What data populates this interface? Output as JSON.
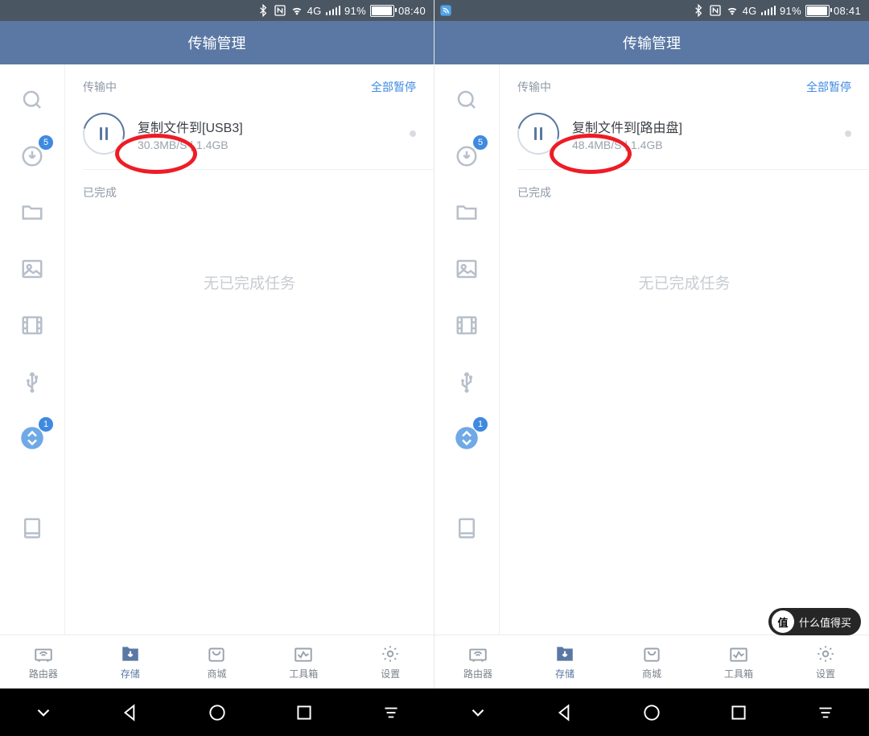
{
  "screens": [
    {
      "status": {
        "time": "08:40",
        "battery_pct": "91%",
        "has_cast_badge": false
      },
      "header": {
        "title": "传输管理"
      },
      "side": {
        "download_badge": "5",
        "transfer_badge": "1"
      },
      "main": {
        "section_transfer": "传输中",
        "pause_all": "全部暂停",
        "task_title": "复制文件到[USB3]",
        "task_speed": "30.3MB/S",
        "task_sep": " | ",
        "task_size": "1.4GB",
        "section_done": "已完成",
        "empty": "无已完成任务"
      },
      "tabs": {
        "router": "路由器",
        "storage": "存储",
        "store": "商城",
        "tools": "工具箱",
        "settings": "设置"
      }
    },
    {
      "status": {
        "time": "08:41",
        "battery_pct": "91%",
        "has_cast_badge": true
      },
      "header": {
        "title": "传输管理"
      },
      "side": {
        "download_badge": "5",
        "transfer_badge": "1"
      },
      "main": {
        "section_transfer": "传输中",
        "pause_all": "全部暂停",
        "task_title": "复制文件到[路由盘]",
        "task_speed": "48.4MB/S",
        "task_sep": " | ",
        "task_size": "1.4GB",
        "section_done": "已完成",
        "empty": "无已完成任务"
      },
      "tabs": {
        "router": "路由器",
        "storage": "存储",
        "store": "商城",
        "tools": "工具箱",
        "settings": "设置"
      }
    }
  ],
  "watermark": "什么值得买",
  "watermark_badge": "值"
}
